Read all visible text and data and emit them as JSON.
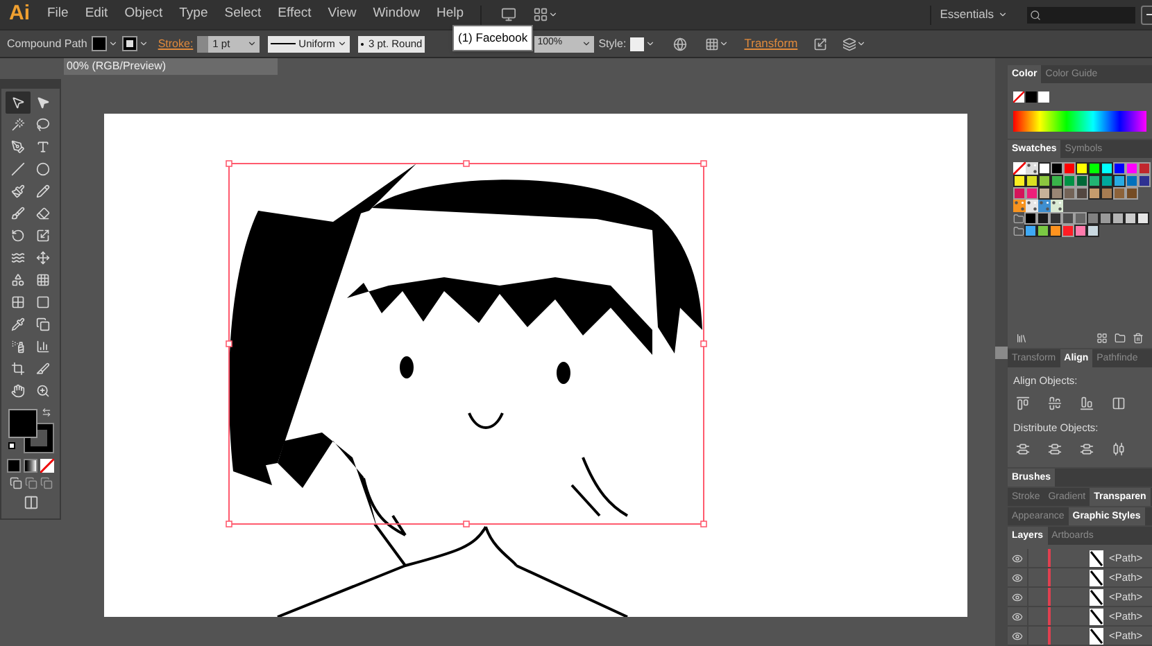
{
  "app_logo": "Ai",
  "menu": [
    "File",
    "Edit",
    "Object",
    "Type",
    "Select",
    "Effect",
    "View",
    "Window",
    "Help"
  ],
  "workspace": "Essentials",
  "tooltip": "(1) Facebook",
  "control_bar": {
    "selection": "Compound Path",
    "stroke_label": "Stroke:",
    "stroke_weight": "1 pt",
    "profile": "Uniform",
    "brush": "3 pt. Round",
    "opacity": "100%",
    "style_label": "Style:",
    "transform_link": "Transform"
  },
  "document_tab": "00% (RGB/Preview)",
  "tools": [
    {
      "kind": "selection",
      "selected": true
    },
    {
      "kind": "direct-selection",
      "selected": false
    },
    {
      "kind": "magic-wand",
      "selected": false
    },
    {
      "kind": "lasso",
      "selected": false
    },
    {
      "kind": "pen",
      "selected": false
    },
    {
      "kind": "type",
      "selected": false
    },
    {
      "kind": "line",
      "selected": false
    },
    {
      "kind": "ellipse",
      "selected": false
    },
    {
      "kind": "paintbrush",
      "selected": false
    },
    {
      "kind": "pencil",
      "selected": false
    },
    {
      "kind": "blob-brush",
      "selected": false
    },
    {
      "kind": "eraser",
      "selected": false
    },
    {
      "kind": "rotate",
      "selected": false
    },
    {
      "kind": "scale",
      "selected": false
    },
    {
      "kind": "warp",
      "selected": false
    },
    {
      "kind": "free-transform",
      "selected": false
    },
    {
      "kind": "shape-builder",
      "selected": false
    },
    {
      "kind": "perspective",
      "selected": false
    },
    {
      "kind": "mesh",
      "selected": false
    },
    {
      "kind": "gradient",
      "selected": false
    },
    {
      "kind": "eyedropper",
      "selected": false
    },
    {
      "kind": "blend",
      "selected": false
    },
    {
      "kind": "symbol-sprayer",
      "selected": false
    },
    {
      "kind": "graph",
      "selected": false
    },
    {
      "kind": "artboard",
      "selected": false
    },
    {
      "kind": "slice",
      "selected": false
    },
    {
      "kind": "hand",
      "selected": false
    },
    {
      "kind": "zoom",
      "selected": false
    }
  ],
  "color_panel": {
    "tabs": [
      {
        "label": "Color",
        "selected": true
      },
      {
        "label": "Color Guide",
        "selected": false
      }
    ]
  },
  "swatches_panel": {
    "tabs": [
      {
        "label": "Swatches",
        "selected": true
      },
      {
        "label": "Symbols",
        "selected": false
      }
    ],
    "rows": [
      [
        {
          "kind": "none"
        },
        {
          "kind": "pattern"
        },
        {
          "kind": "solid",
          "color": "#ffffff"
        },
        {
          "kind": "solid",
          "color": "#000000"
        },
        {
          "kind": "solid",
          "color": "#ff0000"
        },
        {
          "kind": "solid",
          "color": "#ffff00"
        },
        {
          "kind": "solid",
          "color": "#00ff00"
        },
        {
          "kind": "solid",
          "color": "#00ffff"
        },
        {
          "kind": "solid",
          "color": "#0000ff"
        },
        {
          "kind": "solid",
          "color": "#ff00ff"
        },
        {
          "kind": "solid",
          "color": "#c1272d"
        }
      ],
      [
        {
          "kind": "solid",
          "color": "#fcee21"
        },
        {
          "kind": "solid",
          "color": "#d9e021"
        },
        {
          "kind": "solid",
          "color": "#8cc63f"
        },
        {
          "kind": "solid",
          "color": "#39b54a"
        },
        {
          "kind": "solid",
          "color": "#009245"
        },
        {
          "kind": "solid",
          "color": "#006837"
        },
        {
          "kind": "solid",
          "color": "#22b573"
        },
        {
          "kind": "solid",
          "color": "#00a99d"
        },
        {
          "kind": "solid",
          "color": "#29abe2"
        },
        {
          "kind": "solid",
          "color": "#0071bc"
        },
        {
          "kind": "solid",
          "color": "#2e3192"
        }
      ],
      [
        {
          "kind": "solid",
          "color": "#d4145a"
        },
        {
          "kind": "solid",
          "color": "#ed1e79"
        },
        {
          "kind": "solid",
          "color": "#c7b299"
        },
        {
          "kind": "solid",
          "color": "#998675"
        },
        {
          "kind": "solid",
          "color": "#736357"
        },
        {
          "kind": "solid",
          "color": "#534741"
        },
        {
          "kind": "solid",
          "color": "#c69c6d"
        },
        {
          "kind": "solid",
          "color": "#a67c52"
        },
        {
          "kind": "solid",
          "color": "#8c6239"
        },
        {
          "kind": "solid",
          "color": "#754c24"
        }
      ],
      [
        {
          "kind": "pattern",
          "color": "#f7931e"
        },
        {
          "kind": "pattern",
          "color": "#e6e6e6"
        },
        {
          "kind": "pattern",
          "color": "#3f8fd0"
        },
        {
          "kind": "pattern",
          "color": "#d9ead3"
        }
      ],
      [
        {
          "kind": "folder"
        },
        {
          "kind": "solid",
          "color": "#000000"
        },
        {
          "kind": "solid",
          "color": "#1a1a1a"
        },
        {
          "kind": "solid",
          "color": "#333333"
        },
        {
          "kind": "solid",
          "color": "#4d4d4d"
        },
        {
          "kind": "solid",
          "color": "#666666"
        },
        {
          "kind": "solid",
          "color": "#808080"
        },
        {
          "kind": "solid",
          "color": "#999999"
        },
        {
          "kind": "solid",
          "color": "#b3b3b3"
        },
        {
          "kind": "solid",
          "color": "#cccccc"
        },
        {
          "kind": "solid",
          "color": "#e6e6e6"
        }
      ],
      [
        {
          "kind": "folder"
        },
        {
          "kind": "solid",
          "color": "#3fa9f5"
        },
        {
          "kind": "solid",
          "color": "#7ac943"
        },
        {
          "kind": "solid",
          "color": "#ff931e"
        },
        {
          "kind": "solid",
          "color": "#ff1d25"
        },
        {
          "kind": "solid",
          "color": "#ff7bac"
        },
        {
          "kind": "solid",
          "color": "#c9d8e0"
        }
      ]
    ]
  },
  "align_panel": {
    "tabs": [
      {
        "label": "Transform",
        "selected": false
      },
      {
        "label": "Align",
        "selected": true
      },
      {
        "label": "Pathfinde",
        "selected": false
      }
    ],
    "align_label": "Align Objects:",
    "distribute_label": "Distribute Objects:"
  },
  "brushes_panel": {
    "tabs": [
      {
        "label": "Brushes",
        "selected": true
      }
    ]
  },
  "stroke_panel": {
    "tabs": [
      {
        "label": "Stroke",
        "selected": false
      },
      {
        "label": "Gradient",
        "selected": false
      },
      {
        "label": "Transparen",
        "selected": true
      }
    ]
  },
  "appearance_panel": {
    "tabs": [
      {
        "label": "Appearance",
        "selected": false
      },
      {
        "label": "Graphic Styles",
        "selected": true
      }
    ]
  },
  "layers_panel": {
    "tabs": [
      {
        "label": "Layers",
        "selected": true
      },
      {
        "label": "Artboards",
        "selected": false
      }
    ],
    "rows": [
      {
        "name": "<Path>",
        "visible": true
      },
      {
        "name": "<Path>",
        "visible": true
      },
      {
        "name": "<Path>",
        "visible": true
      },
      {
        "name": "<Path>",
        "visible": true
      },
      {
        "name": "<Path>",
        "visible": true
      }
    ]
  }
}
